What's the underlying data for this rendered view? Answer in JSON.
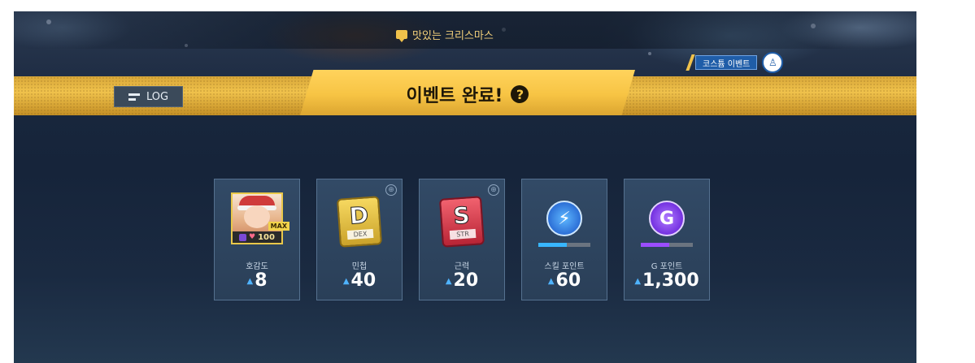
{
  "header": {
    "event_name": "맛있는 크리스마스",
    "costume_event_label": "코스튬 이벤트",
    "log_label": "LOG",
    "title": "이벤트 완료!",
    "help_glyph": "?"
  },
  "rewards": [
    {
      "name": "호감도",
      "value": "8",
      "affinity": "100",
      "max_label": "MAX",
      "zoom": false
    },
    {
      "name": "민첩",
      "value": "40",
      "stat_letter": "D",
      "stat_sub": "DEX",
      "zoom": true
    },
    {
      "name": "근력",
      "value": "20",
      "stat_letter": "S",
      "stat_sub": "STR",
      "zoom": true
    },
    {
      "name": "스킬 포인트",
      "value": "60",
      "progress": 0.55,
      "color": "#38b6ff"
    },
    {
      "name": "G 포인트",
      "value": "1,300",
      "progress": 0.55,
      "color": "#9b4dff"
    }
  ],
  "colors": {
    "gold": "#f0c24c",
    "dark_bg": "#16243a",
    "skill_blue": "#38b6ff",
    "g_purple": "#9b4dff"
  },
  "icons": {
    "increase": "▲",
    "zoom": "⊕",
    "skill": "⚡",
    "g_point": "G"
  }
}
